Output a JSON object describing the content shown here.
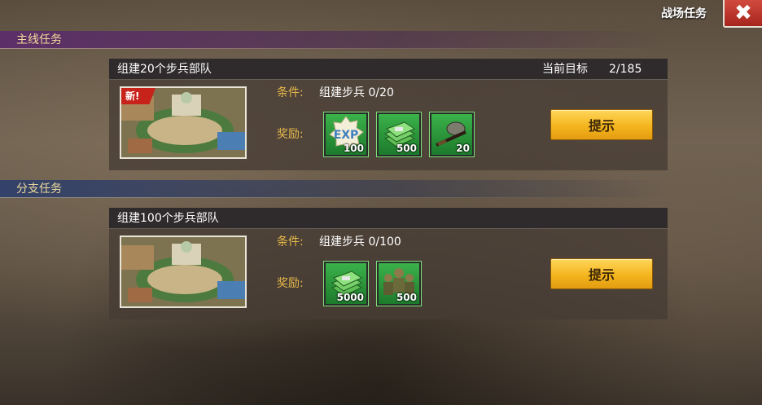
{
  "window": {
    "title": "战场任务",
    "close_label": "✖"
  },
  "sections": {
    "main": "主线任务",
    "branch": "分支任务"
  },
  "quests": [
    {
      "title": "组建20个步兵部队",
      "goal_label": "当前目标",
      "goal_value": "2/185",
      "new_badge": "新!",
      "condition_label": "条件:",
      "condition_value": "组建步兵 0/20",
      "reward_label": "奖励:",
      "rewards": [
        {
          "icon": "exp-icon",
          "amount": "100"
        },
        {
          "icon": "cash-icon",
          "amount": "500"
        },
        {
          "icon": "rifle-helmet-icon",
          "amount": "20"
        }
      ],
      "hint_label": "提示"
    },
    {
      "title": "组建100个步兵部队",
      "condition_label": "条件:",
      "condition_value": "组建步兵 0/100",
      "reward_label": "奖励:",
      "rewards": [
        {
          "icon": "cash-icon",
          "amount": "5000"
        },
        {
          "icon": "soldiers-icon",
          "amount": "500"
        }
      ],
      "hint_label": "提示"
    }
  ],
  "colors": {
    "accent_gold": "#e6b84a",
    "button_yellow": "#f4b51e",
    "close_red": "#c0342a",
    "reward_green": "#2f9a3c"
  }
}
